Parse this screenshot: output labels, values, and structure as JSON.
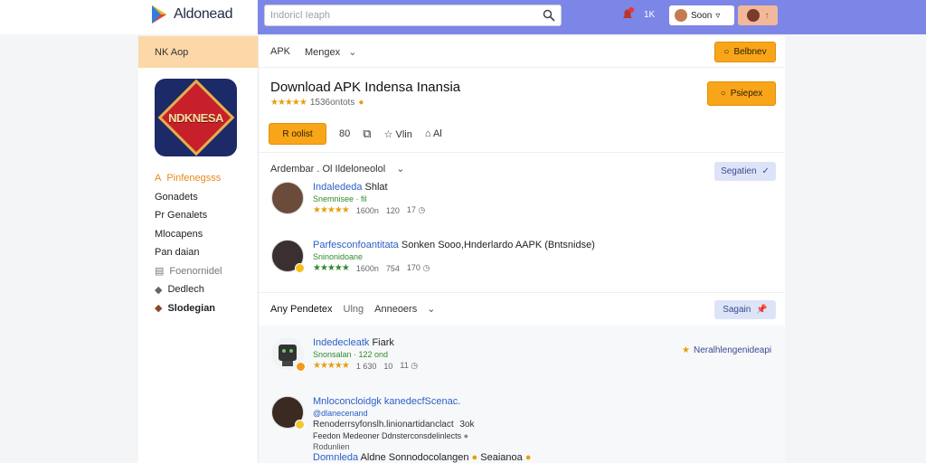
{
  "header": {
    "logo_text": "Aldonead",
    "search_placeholder": "Indoricl Ieaph",
    "notif_count": "1K",
    "user_label": "Soon",
    "profile_label": "↑"
  },
  "sidebar": {
    "head": "NK Aop",
    "app_icon_text": "NDKNESA",
    "items": [
      {
        "label": "Pinfenegsss",
        "prefix": "A",
        "state": "active"
      },
      {
        "label": "Gonadets",
        "state": "normal"
      },
      {
        "label": "Pr Genalets",
        "state": "normal"
      },
      {
        "label": "Mlocapens",
        "state": "normal"
      },
      {
        "label": "Pan daian",
        "state": "normal"
      },
      {
        "label": "Foenornidel",
        "state": "muted"
      },
      {
        "label": "Dedlech",
        "state": "normal"
      },
      {
        "label": "Slodegian",
        "state": "normal"
      }
    ]
  },
  "main": {
    "crumbs": [
      "APK",
      "Mengex"
    ],
    "top_button": "Belbnev",
    "title": "Download APK Indensa Inansia",
    "rating_text": "1536ontots",
    "primary_button": "Psiepex",
    "actions": {
      "install": "R oolist",
      "a1": "80",
      "a3": "Vlin",
      "a4": "Al"
    },
    "section1": {
      "title": "Ardembar . Ol Ildeloneolol",
      "button": "Segatien"
    },
    "section2": {
      "tabs": [
        "Any Pendetex",
        "Ulng",
        "Anneoers"
      ],
      "button": "Sagain"
    },
    "items": [
      {
        "title": "Indalededa",
        "title_rest": "Shlat",
        "sub": "Snemnisee · fil",
        "meta": [
          "1600n",
          "120",
          "17"
        ]
      },
      {
        "title": "Parfesconfoantitata",
        "title_rest": "Sonken Sooo,Hnderlardo AAPK (Bntsnidse)",
        "sub": "Sninonidoane",
        "meta": [
          "1600n",
          "754",
          "170"
        ]
      },
      {
        "title": "Indedecleatk",
        "title_rest": "Fiark",
        "sub": "Snonsalan · 122 ond",
        "meta": [
          "1 630",
          "10",
          "11"
        ]
      },
      {
        "title": "Mnloconcloidgk",
        "title_rest": "kanedecfScenac.",
        "sub": "@dlanecenand",
        "line1": "Renoderrsyfonslh.linionartidanclact",
        "line1_tail": "3ok",
        "line2": "Feedon Medeoner Ddnsterconsdelinlects",
        "line3": "Rodunlien"
      },
      {
        "title": "Domnleda",
        "title_rest": "Aldne Sonnodocolangen",
        "tail": "Seaianoa"
      }
    ],
    "pin_note": "Neralhlengenideapi"
  }
}
